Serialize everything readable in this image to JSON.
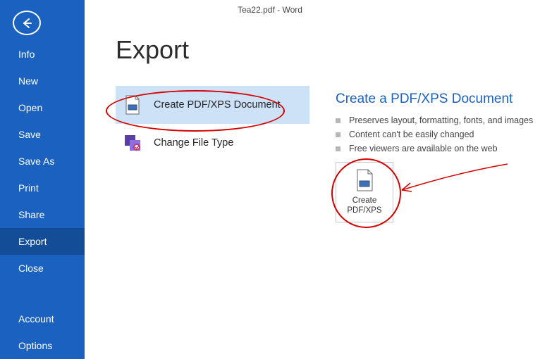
{
  "app_title": "Tea22.pdf - Word",
  "sidebar": {
    "items": [
      {
        "label": "Info"
      },
      {
        "label": "New"
      },
      {
        "label": "Open"
      },
      {
        "label": "Save"
      },
      {
        "label": "Save As"
      },
      {
        "label": "Print"
      },
      {
        "label": "Share"
      },
      {
        "label": "Export"
      },
      {
        "label": "Close"
      }
    ],
    "bottom_items": [
      {
        "label": "Account"
      },
      {
        "label": "Options"
      }
    ],
    "active_index": 7
  },
  "page": {
    "heading": "Export",
    "options": [
      {
        "label": "Create PDF/XPS Document"
      },
      {
        "label": "Change File Type"
      }
    ],
    "selected_option_index": 0
  },
  "right_panel": {
    "heading": "Create a PDF/XPS Document",
    "bullets": [
      "Preserves layout, formatting, fonts, and images",
      "Content can't be easily changed",
      "Free viewers are available on the web"
    ],
    "button_line1": "Create",
    "button_line2": "PDF/XPS"
  }
}
